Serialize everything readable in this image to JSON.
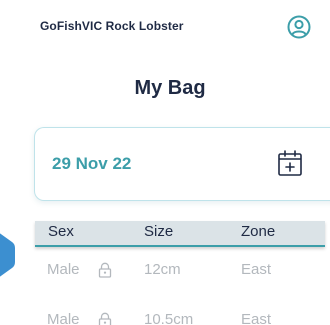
{
  "header": {
    "app_title": "GoFishVIC Rock Lobster",
    "profile_icon": "user-circle-icon"
  },
  "page": {
    "title": "My Bag"
  },
  "date_card": {
    "date": "29 Nov 22",
    "calendar_icon": "calendar-add-icon"
  },
  "table": {
    "columns": [
      "Sex",
      "Size",
      "Zone"
    ],
    "rows": [
      {
        "sex": "Male",
        "size": "12cm",
        "zone": "East",
        "icon": "lock-icon"
      },
      {
        "sex": "Male",
        "size": "10.5cm",
        "zone": "East",
        "icon": "lock-icon"
      }
    ]
  },
  "colors": {
    "accent": "#3c9ea9",
    "title_text": "#1f2a44",
    "muted_text": "#b3b8bd",
    "header_bg": "#dbe3e7",
    "side_tab": "#3c8fd0"
  }
}
